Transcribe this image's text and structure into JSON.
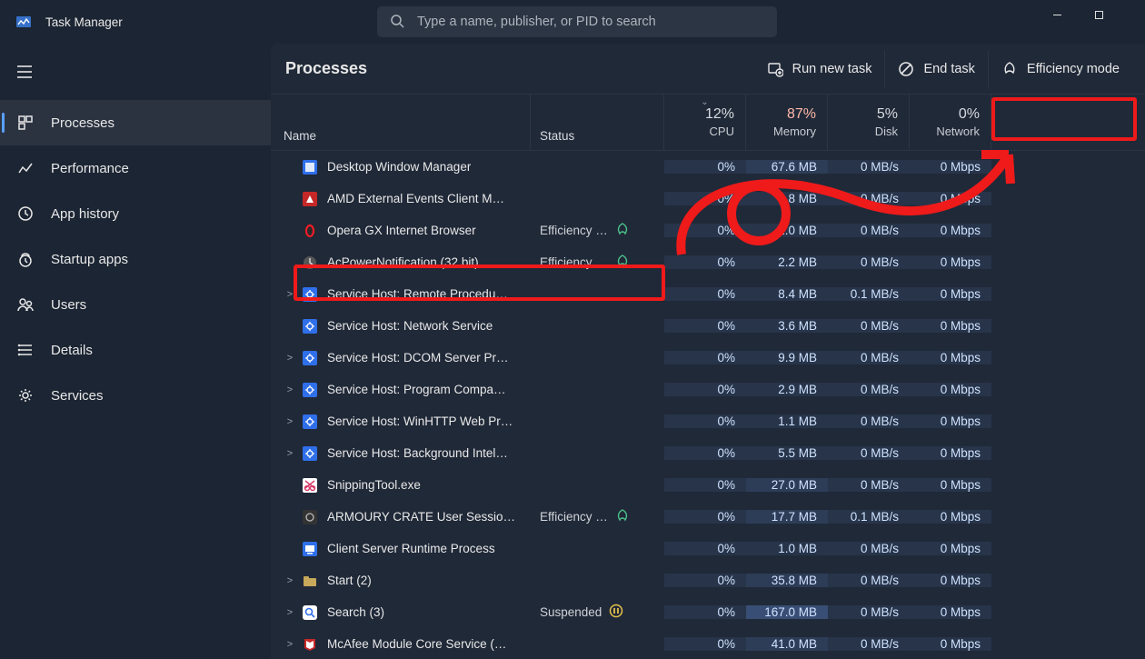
{
  "app": {
    "title": "Task Manager"
  },
  "search": {
    "placeholder": "Type a name, publisher, or PID to search"
  },
  "sidebar": {
    "items": [
      {
        "label": "Processes",
        "active": true
      },
      {
        "label": "Performance",
        "active": false
      },
      {
        "label": "App history",
        "active": false
      },
      {
        "label": "Startup apps",
        "active": false
      },
      {
        "label": "Users",
        "active": false
      },
      {
        "label": "Details",
        "active": false
      },
      {
        "label": "Services",
        "active": false
      }
    ]
  },
  "toolbar": {
    "heading": "Processes",
    "run_new_task": "Run new task",
    "end_task": "End task",
    "efficiency_mode": "Efficiency mode"
  },
  "columns": {
    "name": "Name",
    "status": "Status",
    "cpu": {
      "pct": "12%",
      "label": "CPU"
    },
    "memory": {
      "pct": "87%",
      "label": "Memory"
    },
    "disk": {
      "pct": "5%",
      "label": "Disk"
    },
    "network": {
      "pct": "0%",
      "label": "Network"
    }
  },
  "status_labels": {
    "efficiency": "Efficiency …",
    "suspended": "Suspended"
  },
  "rows": [
    {
      "exp": "",
      "icon": "dwm",
      "name": "Desktop Window Manager",
      "status": "",
      "badge": "",
      "cpu": "0%",
      "mem": "67.6 MB",
      "disk": "0 MB/s",
      "net": "0 Mbps"
    },
    {
      "exp": "",
      "icon": "amd",
      "name": "AMD External Events Client M…",
      "status": "",
      "badge": "",
      "cpu": "0%",
      "mem": "1.8 MB",
      "disk": "0 MB/s",
      "net": "0 Mbps"
    },
    {
      "exp": "",
      "icon": "opera",
      "name": "Opera GX Internet Browser",
      "status": "efficiency",
      "badge": "leaf",
      "cpu": "0%",
      "mem": "1.0 MB",
      "disk": "0 MB/s",
      "net": "0 Mbps"
    },
    {
      "exp": "",
      "icon": "acpower",
      "name": "AcPowerNotification (32 bit)",
      "status": "efficiency",
      "badge": "leaf",
      "cpu": "0%",
      "mem": "2.2 MB",
      "disk": "0 MB/s",
      "net": "0 Mbps"
    },
    {
      "exp": ">",
      "icon": "svchost",
      "name": "Service Host: Remote Procedu…",
      "status": "",
      "badge": "",
      "cpu": "0%",
      "mem": "8.4 MB",
      "disk": "0.1 MB/s",
      "net": "0 Mbps"
    },
    {
      "exp": "",
      "icon": "svchost",
      "name": "Service Host: Network Service",
      "status": "",
      "badge": "",
      "cpu": "0%",
      "mem": "3.6 MB",
      "disk": "0 MB/s",
      "net": "0 Mbps"
    },
    {
      "exp": ">",
      "icon": "svchost",
      "name": "Service Host: DCOM Server Pr…",
      "status": "",
      "badge": "",
      "cpu": "0%",
      "mem": "9.9 MB",
      "disk": "0 MB/s",
      "net": "0 Mbps"
    },
    {
      "exp": ">",
      "icon": "svchost",
      "name": "Service Host: Program Compa…",
      "status": "",
      "badge": "",
      "cpu": "0%",
      "mem": "2.9 MB",
      "disk": "0 MB/s",
      "net": "0 Mbps"
    },
    {
      "exp": ">",
      "icon": "svchost",
      "name": "Service Host: WinHTTP Web Pr…",
      "status": "",
      "badge": "",
      "cpu": "0%",
      "mem": "1.1 MB",
      "disk": "0 MB/s",
      "net": "0 Mbps"
    },
    {
      "exp": ">",
      "icon": "svchost",
      "name": "Service Host: Background Intel…",
      "status": "",
      "badge": "",
      "cpu": "0%",
      "mem": "5.5 MB",
      "disk": "0 MB/s",
      "net": "0 Mbps"
    },
    {
      "exp": "",
      "icon": "snip",
      "name": "SnippingTool.exe",
      "status": "",
      "badge": "",
      "cpu": "0%",
      "mem": "27.0 MB",
      "disk": "0 MB/s",
      "net": "0 Mbps"
    },
    {
      "exp": "",
      "icon": "armoury",
      "name": "ARMOURY CRATE User Sessio…",
      "status": "efficiency",
      "badge": "leaf",
      "cpu": "0%",
      "mem": "17.7 MB",
      "disk": "0.1 MB/s",
      "net": "0 Mbps"
    },
    {
      "exp": "",
      "icon": "csrss",
      "name": "Client Server Runtime Process",
      "status": "",
      "badge": "",
      "cpu": "0%",
      "mem": "1.0 MB",
      "disk": "0 MB/s",
      "net": "0 Mbps"
    },
    {
      "exp": ">",
      "icon": "folder",
      "name": "Start (2)",
      "status": "",
      "badge": "",
      "cpu": "0%",
      "mem": "35.8 MB",
      "disk": "0 MB/s",
      "net": "0 Mbps"
    },
    {
      "exp": ">",
      "icon": "search",
      "name": "Search (3)",
      "status": "suspended",
      "badge": "pause",
      "cpu": "0%",
      "mem": "167.0 MB",
      "disk": "0 MB/s",
      "net": "0 Mbps"
    },
    {
      "exp": ">",
      "icon": "mcafee",
      "name": "McAfee Module Core Service (…",
      "status": "",
      "badge": "",
      "cpu": "0%",
      "mem": "41.0 MB",
      "disk": "0 MB/s",
      "net": "0 Mbps"
    }
  ]
}
